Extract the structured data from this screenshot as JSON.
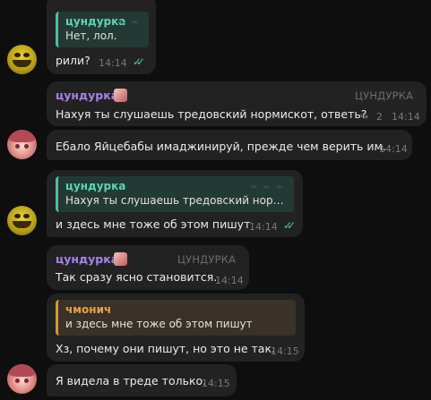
{
  "messages": [
    {
      "reply_name": "цундурка",
      "reply_text": "Нет, лол.",
      "text": "рили?",
      "time": "14:14",
      "checks": "✓✓"
    },
    {
      "sender": "цундурка",
      "role": "ЦУНДУРКА",
      "text": "Нахуя ты слушаешь тредовский нормискот, ответь?",
      "reply_count": "2",
      "time": "14:14"
    },
    {
      "text": "Ебало Яйцебабы имаджинируй, прежде чем верить им.",
      "time": "14:14"
    },
    {
      "reply_name": "цундурка",
      "reply_text": "Нахуя ты слушаешь тредовский норм...",
      "text": "и здесь мне тоже об этом пишут",
      "time": "14:14",
      "checks": "✓✓"
    },
    {
      "sender": "цундурка",
      "role": "ЦУНДУРКА",
      "text": "Так сразу ясно становится.",
      "time": "14:14"
    },
    {
      "reply_name": "чмонич",
      "reply_text": "и здесь мне тоже об этом пишут",
      "text": "Хз, почему они пишут, но это не так.",
      "time": "14:15"
    },
    {
      "text": "Я видела в треде только.",
      "time": "14:15"
    }
  ],
  "icons": {
    "reply_arrow": "reply-arrow-icon",
    "read_checks": "double-check-icon"
  },
  "colors": {
    "background": "#0e0e0e",
    "bubble": "#222222",
    "sender_name": "#a883e8",
    "reply_green": "#4fbfa0",
    "reply_orange": "#d8963f",
    "checks": "#5fbfa8"
  }
}
